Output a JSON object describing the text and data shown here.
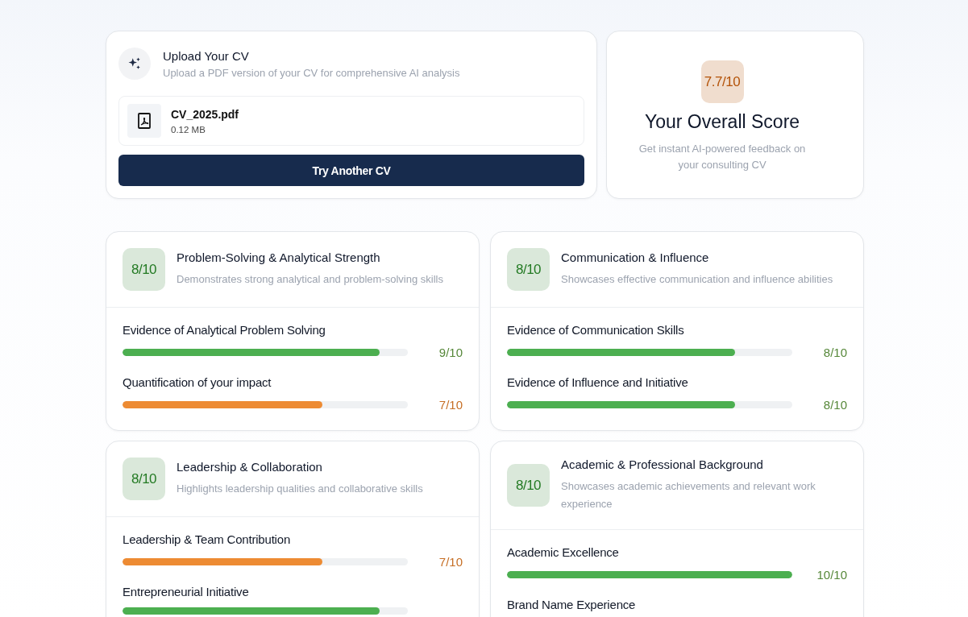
{
  "upload": {
    "title": "Upload Your CV",
    "subtitle": "Upload a PDF version of your CV for comprehensive AI analysis",
    "file": {
      "name": "CV_2025.pdf",
      "size": "0.12 MB"
    },
    "button": "Try Another CV"
  },
  "overall": {
    "score": "7.7/10",
    "color": "#b45309",
    "title": "Your Overall Score",
    "description": "Get instant AI-powered feedback on your consulting CV"
  },
  "categories": [
    {
      "score": "8/10",
      "color": "#237a23",
      "title": "Problem-Solving & Analytical Strength",
      "description": "Demonstrates strong analytical and problem-solving skills",
      "criteria": [
        {
          "label": "Evidence of Analytical Problem Solving",
          "level": 0.9,
          "score": "9/10",
          "color": "#4caf50"
        },
        {
          "label": "Quantification of your impact",
          "level": 0.7,
          "score": "7/10",
          "color": "#ed8b33"
        }
      ]
    },
    {
      "score": "8/10",
      "color": "#237a23",
      "title": "Communication & Influence",
      "description": "Showcases effective communication and influence abilities",
      "criteria": [
        {
          "label": "Evidence of Communication Skills",
          "level": 0.8,
          "score": "8/10",
          "color": "#4caf50"
        },
        {
          "label": "Evidence of Influence and Initiative",
          "level": 0.8,
          "score": "8/10",
          "color": "#4caf50"
        }
      ]
    },
    {
      "score": "8/10",
      "color": "#237a23",
      "title": "Leadership & Collaboration",
      "description": "Highlights leadership qualities and collaborative skills",
      "criteria": [
        {
          "label": "Leadership & Team Contribution",
          "level": 0.7,
          "score": "7/10",
          "color": "#ed8b33"
        },
        {
          "label": "Entrepreneurial Initiative",
          "level": 0.9,
          "color": "#4caf50"
        }
      ]
    },
    {
      "score": "8/10",
      "color": "#237a23",
      "title": "Academic & Professional Background",
      "description": "Showcases academic achievements and relevant work experience",
      "criteria": [
        {
          "label": "Academic Excellence",
          "level": 1.0,
          "score": "10/10",
          "color": "#4caf50"
        },
        {
          "label": "Brand Name Experience"
        }
      ]
    }
  ]
}
